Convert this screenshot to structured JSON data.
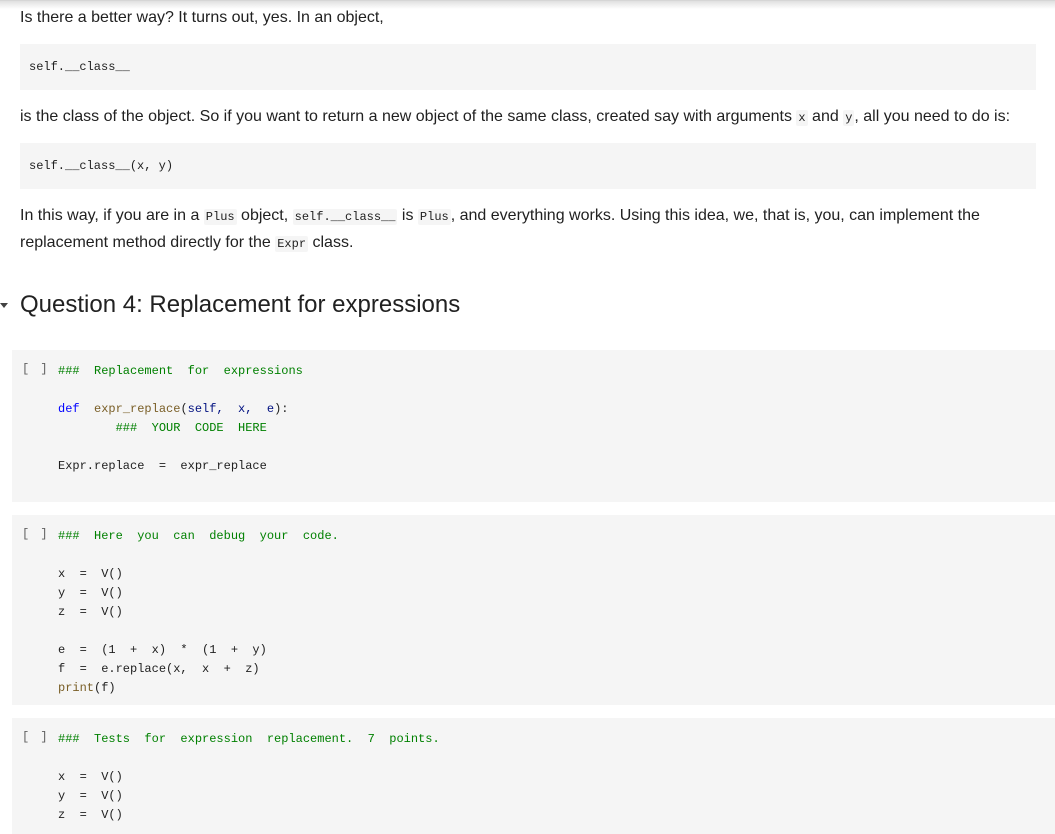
{
  "paragraphs": {
    "p1": "Is there a better way? It turns out, yes. In an object,",
    "code1": "self.__class__",
    "p2": {
      "before": "is the class of the object. So if you want to return a new object of the same class, created say with arguments ",
      "x": "x",
      "and": " and ",
      "y": "y",
      "after": ", all you need to do is:"
    },
    "code2": "self.__class__(x,  y)",
    "p3": {
      "t1": "In this way, if you are in a ",
      "c1": "Plus",
      "t2": " object, ",
      "c2": "self.__class__",
      "t3": " is ",
      "c3": "Plus",
      "t4": ", and everything works. Using this idea, we, that is, you, can implement the",
      "t5": "replacement method directly for the ",
      "c4": "Expr",
      "t6": " class."
    }
  },
  "section": {
    "title": "Question 4: Replacement for expressions"
  },
  "cells": [
    {
      "run_label": "[ ]",
      "lines": [
        {
          "comment": "###  Replacement  for  expressions"
        },
        {
          "blank": ""
        },
        {
          "kw": "def",
          "fn": "expr_replace",
          "rest_open": "(",
          "params": "self,  x,  e",
          "rest_close": "):"
        },
        {
          "indent_comment": "###  YOUR  CODE  HERE"
        },
        {
          "blank": ""
        },
        {
          "text": "Expr.replace  =  expr_replace"
        }
      ]
    },
    {
      "run_label": "[ ]",
      "lines": [
        {
          "comment": "###  Here  you  can  debug  your  code."
        },
        {
          "text": "x  =  V()"
        },
        {
          "text": "y  =  V()"
        },
        {
          "text": "z  =  V()"
        },
        {
          "text": "e  =  (1  +  x)  *  (1  +  y)"
        },
        {
          "text": "f  =  e.replace(x,  x  +  z)"
        },
        {
          "fn": "print",
          "text": "(f)"
        }
      ]
    },
    {
      "run_label": "[ ]",
      "lines": [
        {
          "comment": "###  Tests  for  expression  replacement.  7  points."
        },
        {
          "text": "x  =  V()"
        },
        {
          "text": "y  =  V()"
        },
        {
          "text": "z  =  V()"
        }
      ]
    }
  ]
}
